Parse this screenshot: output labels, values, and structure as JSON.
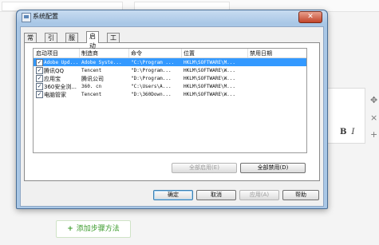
{
  "window": {
    "title": "系统配置",
    "close": "✕"
  },
  "tabs": [
    "常规",
    "引导",
    "服务",
    "启动",
    "工具"
  ],
  "columns": [
    "启动项目",
    "制造商",
    "命令",
    "位置",
    "禁用日期"
  ],
  "rows": [
    {
      "item": "Adobe Upd...",
      "maker": "Adobe Syste...",
      "command": "\"C:\\Program ...",
      "location": "HKLM\\SOFTWARE\\M...",
      "date": "",
      "checked": true,
      "selected": true
    },
    {
      "item": "腾讯QQ",
      "maker": "Tencent",
      "command": "\"D:\\Program...",
      "location": "HKLM\\SOFTWARE\\W...",
      "date": "",
      "checked": true,
      "selected": false
    },
    {
      "item": "应用宝",
      "maker": "腾讯公司",
      "command": "\"D:\\Program...",
      "location": "HKLM\\SOFTWARE\\W...",
      "date": "",
      "checked": true,
      "selected": false
    },
    {
      "item": "360安全浏...",
      "maker": "360. cn",
      "command": "\"C:\\Users\\A...",
      "location": "HKLM\\SOFTWARE\\M...",
      "date": "",
      "checked": true,
      "selected": false
    },
    {
      "item": "电脑管家",
      "maker": "Tencent",
      "command": "\"D:\\360Down...",
      "location": "HKLM\\SOFTWARE\\W...",
      "date": "",
      "checked": true,
      "selected": false
    }
  ],
  "buttons": {
    "enable_all": "全部启用(E)",
    "disable_all": "全部禁用(D)",
    "ok": "确定",
    "cancel": "取消",
    "apply": "应用(A)",
    "help": "帮助"
  },
  "page": {
    "add_method": "添加步骤方法",
    "add_plus": "+",
    "bold": "B",
    "italic": "I",
    "move_icon": "✥",
    "close_icon": "×",
    "add_icon": "+"
  }
}
